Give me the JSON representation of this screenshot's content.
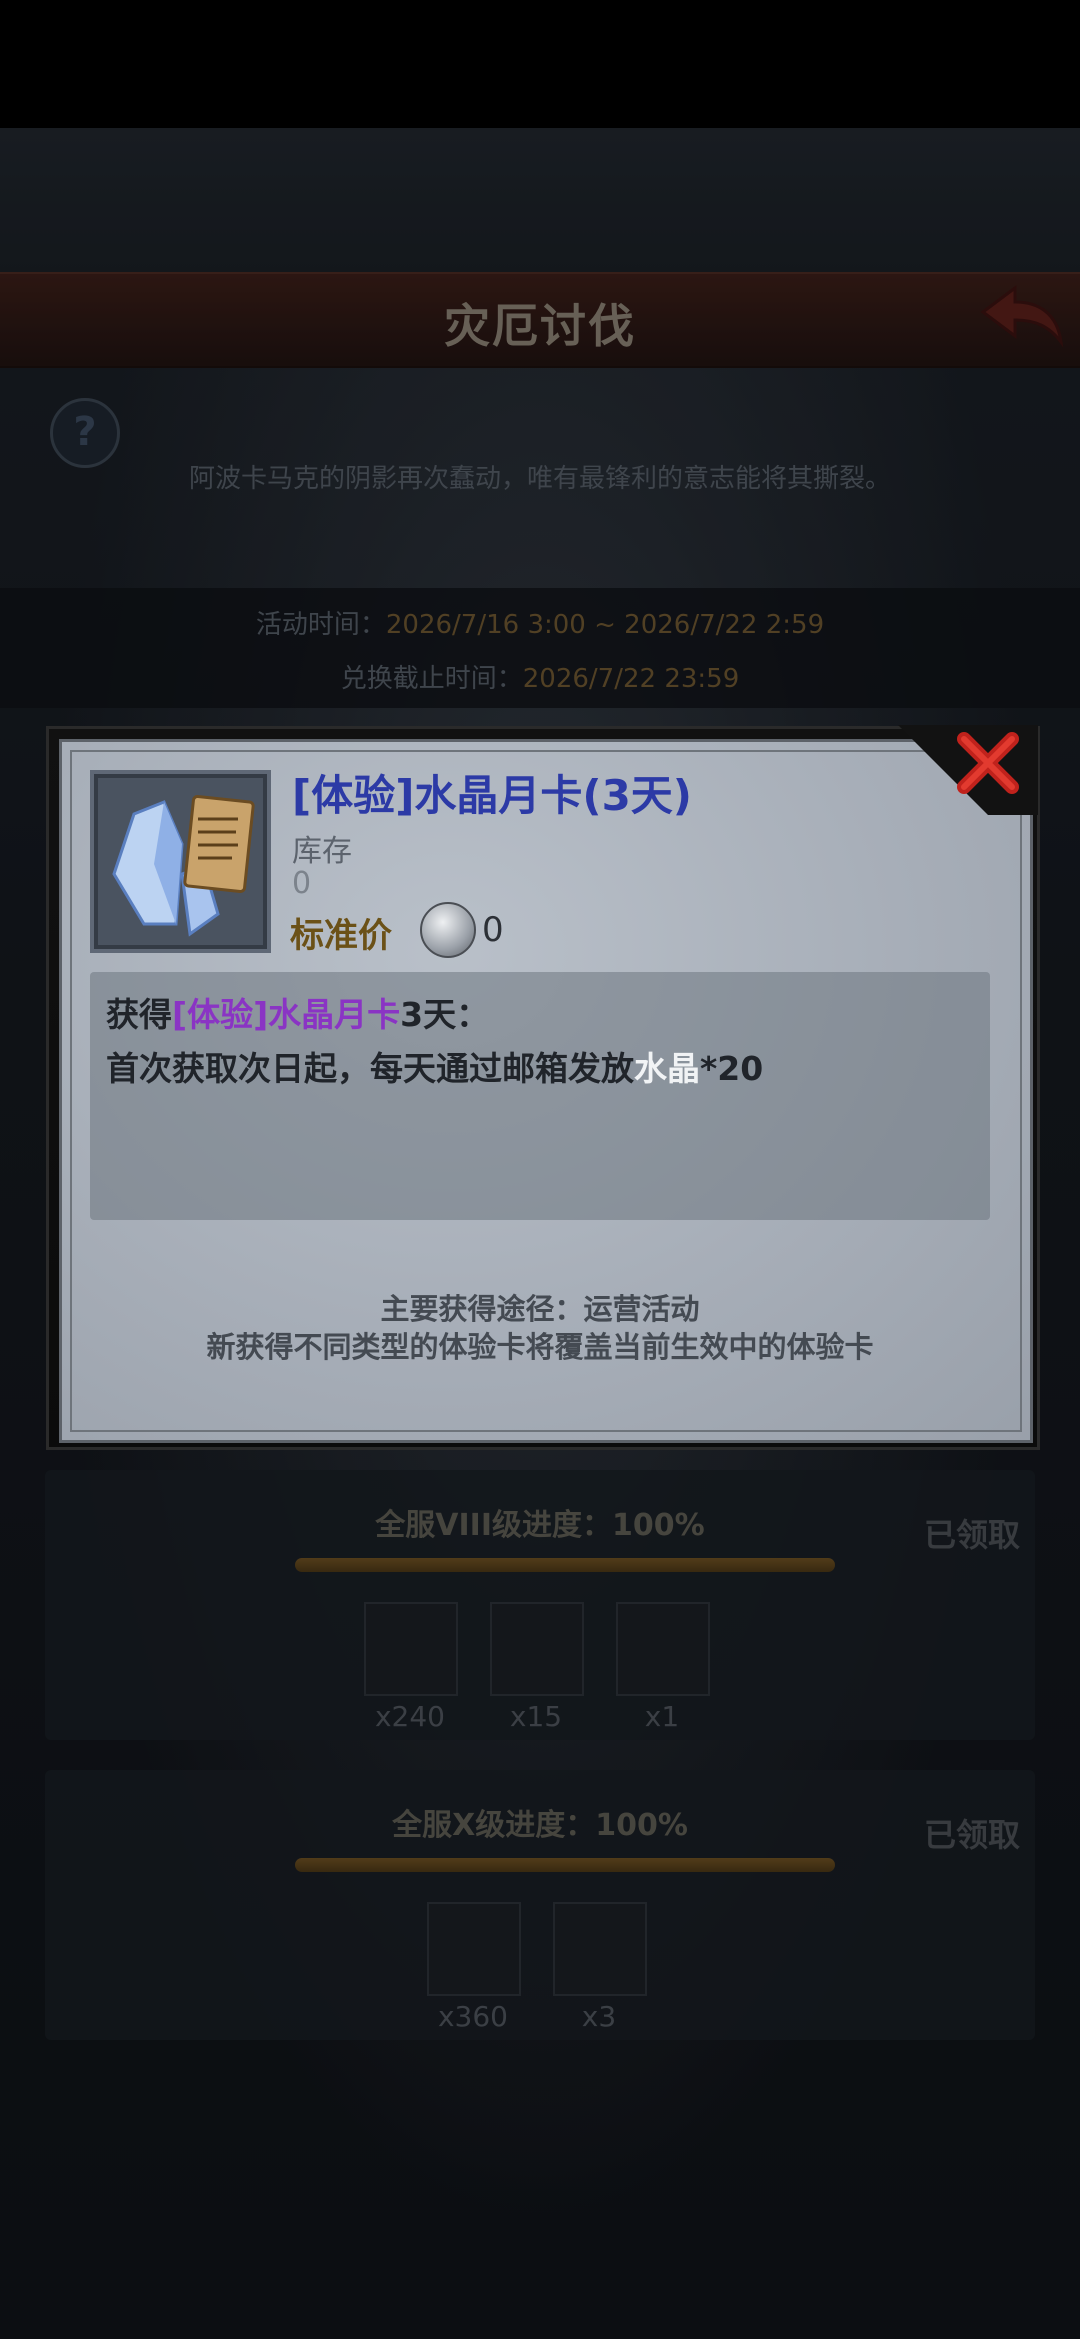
{
  "header": {
    "title": "灾厄讨伐"
  },
  "intro": {
    "description": "阿波卡马克的阴影再次蠢动，唯有最锋利的意志能将其撕裂。"
  },
  "event": {
    "time_label": "活动时间：",
    "time_value": "2026/7/16 3:00 ~ 2026/7/22 2:59",
    "deadline_label": "兑换截止时间：",
    "deadline_value": "2026/7/22 23:59"
  },
  "modal": {
    "item_name": "[体验]水晶月卡(3天)",
    "stock_label": "库存",
    "stock_value": "0",
    "price_label": "标准价",
    "price_value": "0",
    "desc_prefix": "获得",
    "desc_item": "[体验]水晶月卡",
    "desc_suffix": "3天：",
    "desc_line2_prefix": "首次获取次日起，每天通过邮箱发放",
    "desc_line2_item": "水晶",
    "desc_line2_suffix": "*20",
    "source": "主要获得途径：运营活动",
    "note": "新获得不同类型的体验卡将覆盖当前生效中的体验卡"
  },
  "rewards": [
    {
      "title": "全服VIII级进度：100%",
      "status": "已领取",
      "progress": 1.0,
      "items": [
        {
          "icon": "scroll-icon",
          "count": "x240"
        },
        {
          "icon": "chest-icon",
          "count": "x15"
        },
        {
          "icon": "crystal-card-icon",
          "count": "x1"
        }
      ]
    },
    {
      "title": "全服X级进度：100%",
      "status": "已领取",
      "progress": 1.0,
      "items": [
        {
          "icon": "scroll-icon",
          "count": "x360"
        },
        {
          "icon": "potion-icon",
          "count": "x3"
        }
      ]
    }
  ],
  "colors": {
    "accent_red": "#c0221c",
    "item_name": "#2c3aa6",
    "highlight_purple": "#8a34c4",
    "gold": "#6d5022"
  }
}
